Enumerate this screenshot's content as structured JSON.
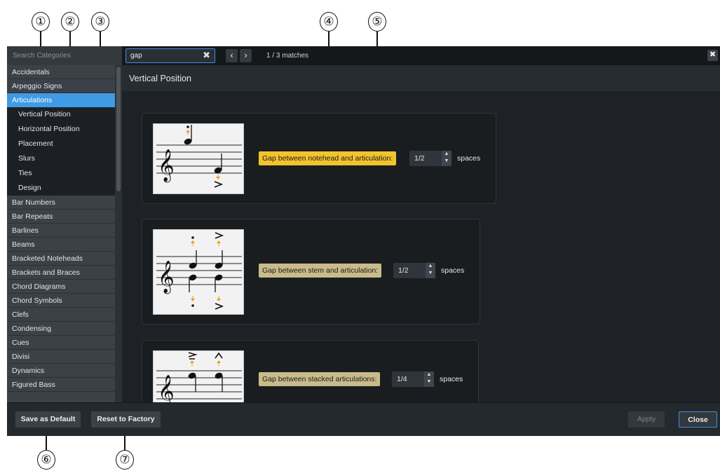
{
  "callouts": [
    "①",
    "②",
    "③",
    "④",
    "⑤",
    "⑥",
    "⑦"
  ],
  "search": {
    "placeholder": "Search Categories"
  },
  "find": {
    "value": "gap",
    "clear_icon": "✖",
    "prev": "‹",
    "next": "›",
    "matches": "1 / 3 matches",
    "close_icon": "✖"
  },
  "sidebar": {
    "top": [
      "Accidentals",
      "Arpeggio Signs"
    ],
    "selected": "Articulations",
    "subs": [
      "Vertical Position",
      "Horizontal Position",
      "Placement",
      "Slurs",
      "Ties",
      "Design"
    ],
    "rest": [
      "Bar Numbers",
      "Bar Repeats",
      "Barlines",
      "Beams",
      "Bracketed Noteheads",
      "Brackets and Braces",
      "Chord Diagrams",
      "Chord Symbols",
      "Clefs",
      "Condensing",
      "Cues",
      "Divisi",
      "Dynamics",
      "Figured Bass"
    ]
  },
  "content": {
    "header": "Vertical Position",
    "options": [
      {
        "label": "Gap between notehead and articulation:",
        "value": "1/2",
        "units": "spaces"
      },
      {
        "label": "Gap between stem and articulation:",
        "value": "1/2",
        "units": "spaces"
      },
      {
        "label": "Gap between stacked articulations:",
        "value": "1/4",
        "units": "spaces"
      }
    ]
  },
  "footer": {
    "save_default": "Save as Default",
    "reset_factory": "Reset to Factory",
    "apply": "Apply",
    "close": "Close"
  },
  "colors": {
    "accent": "#3f9be6",
    "highlight": "#f2c32d",
    "dim_highlight": "#c9bb8a",
    "arrow": "#f29a1c"
  }
}
